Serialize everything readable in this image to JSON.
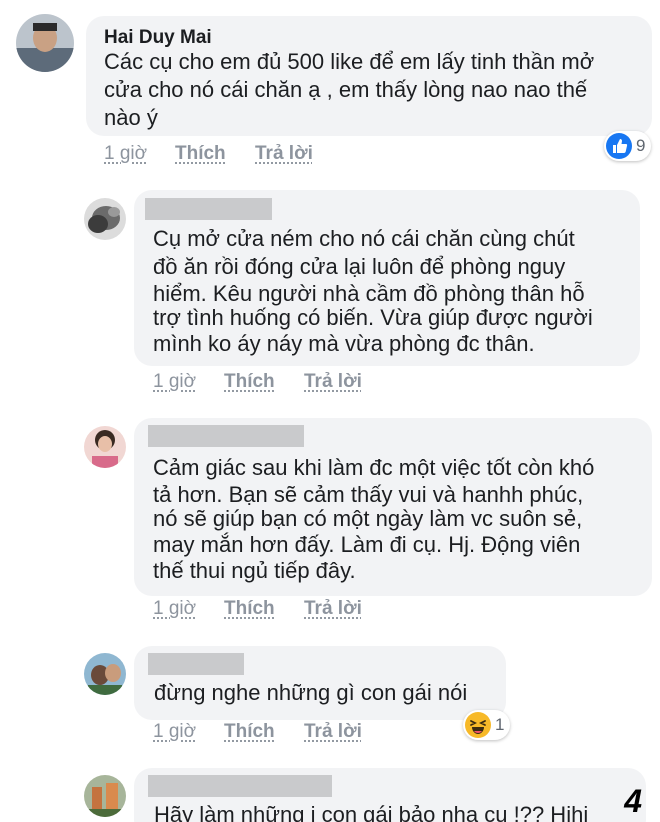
{
  "comments": [
    {
      "author": "Hai Duy Mai",
      "lines": [
        "Các cụ cho em đủ 500 like để em lấy tinh thần mở",
        "cửa cho nó cái chăn ạ , em thấy lòng nao nao thế",
        "nào ý"
      ],
      "time": "1 giờ",
      "like_label": "Thích",
      "reply_label": "Trả lời",
      "reaction": {
        "type": "like-icon",
        "count": "9"
      }
    },
    {
      "author": "",
      "lines": [
        "Cụ mở cửa ném cho nó cái chăn cùng chút",
        "đồ ăn rồi đóng cửa lại luôn để phòng nguy",
        "hiểm. Kêu người nhà cầm đồ phòng thân hỗ",
        "trợ tình huống có biến. Vừa giúp được người",
        "mình ko áy náy mà vừa phòng đc thân."
      ],
      "time": "1 giờ",
      "like_label": "Thích",
      "reply_label": "Trả lời"
    },
    {
      "author": "",
      "lines": [
        "Cảm giác sau khi làm đc một việc tốt còn khó",
        "tả hơn. Bạn sẽ cảm thấy vui và hanhh phúc,",
        "nó sẽ giúp bạn có một ngày làm vc suôn sẻ,",
        "may mắn hơn đấy. Làm đi cụ. Hj. Động viên",
        "thế thui ngủ tiếp đây."
      ],
      "time": "1 giờ",
      "like_label": "Thích",
      "reply_label": "Trả lời"
    },
    {
      "author": "",
      "lines": [
        "đừng nghe những gì con gái nói"
      ],
      "time": "1 giờ",
      "like_label": "Thích",
      "reply_label": "Trả lời",
      "reaction": {
        "type": "haha-icon",
        "count": "1"
      }
    },
    {
      "author": "",
      "lines": [
        "Hãy làm những i con gái bảo nha cụ !?? Hihi"
      ]
    }
  ],
  "page_number": "4",
  "colors": {
    "bubble": "#f2f3f5",
    "meta": "#8d949e",
    "like_blue": "#1877f2",
    "haha_yellow": "#f7b928"
  }
}
